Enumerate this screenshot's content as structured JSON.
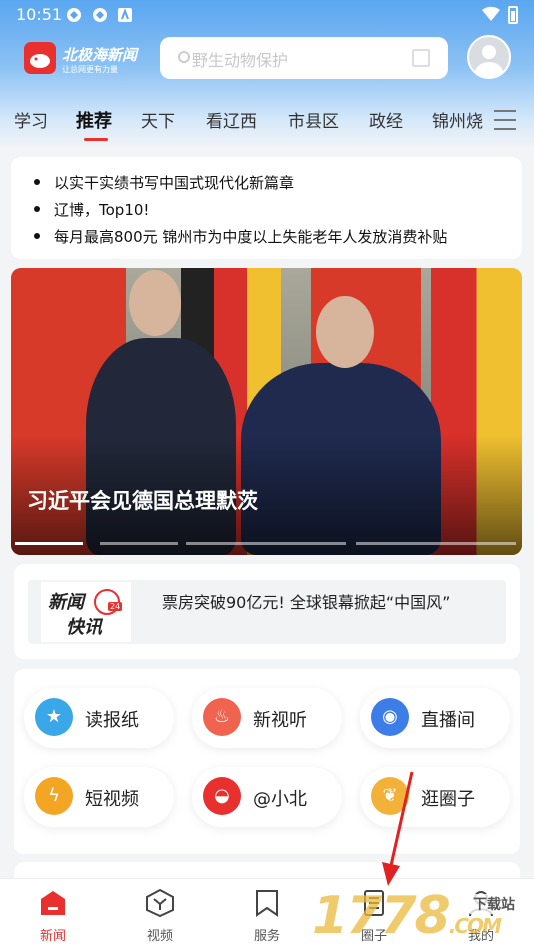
{
  "status_bar": {
    "time": "10:51"
  },
  "app": {
    "name": "北极海新闻",
    "tagline": "让总网更有力量"
  },
  "search": {
    "placeholder": "野生动物保护"
  },
  "tabs": [
    {
      "label": "学习"
    },
    {
      "label": "推荐"
    },
    {
      "label": "天下"
    },
    {
      "label": "看辽西"
    },
    {
      "label": "市县区"
    },
    {
      "label": "政经"
    },
    {
      "label": "锦州烧"
    }
  ],
  "active_tab": "推荐",
  "headlines": [
    "以实干实绩书写中国式现代化新篇章",
    "辽博，Top10!",
    "每月最高800元 锦州市为中度以上失能老年人发放消费补贴"
  ],
  "banner": {
    "caption": "习近平会见德国总理默茨",
    "slide_count": 4,
    "active_slide": 1
  },
  "news_flash": {
    "badge_line1": "新闻",
    "badge_line2": "快讯",
    "badge_number": "24",
    "text": "票房突破90亿元! 全球银幕掀起“中国风”"
  },
  "services": [
    {
      "label": "读报纸",
      "icon": "star-icon",
      "color": "#3aa7e8"
    },
    {
      "label": "新视听",
      "icon": "flame-icon",
      "color": "#f0644f"
    },
    {
      "label": "直播间",
      "icon": "live-icon",
      "color": "#3d7de8"
    },
    {
      "label": "短视频",
      "icon": "bolt-icon",
      "color": "#f3a623"
    },
    {
      "label": "@小北",
      "icon": "whale-icon",
      "color": "#e8302f"
    },
    {
      "label": "逛圈子",
      "icon": "leaf-icon",
      "color": "#f2b23a"
    }
  ],
  "bottom_nav": [
    {
      "label": "新闻",
      "icon": "home-icon",
      "active": true
    },
    {
      "label": "视频",
      "icon": "video-icon",
      "active": false
    },
    {
      "label": "服务",
      "icon": "bookmark-icon",
      "active": false
    },
    {
      "label": "圈子",
      "icon": "doc-icon",
      "active": false
    },
    {
      "label": "我的",
      "icon": "user-icon",
      "active": false
    }
  ],
  "watermark": {
    "text": "1778",
    "suffix": ".COM",
    "badge": "下载站"
  },
  "colors": {
    "accent": "#e8302f",
    "header_blue": "#5aa6f0"
  }
}
